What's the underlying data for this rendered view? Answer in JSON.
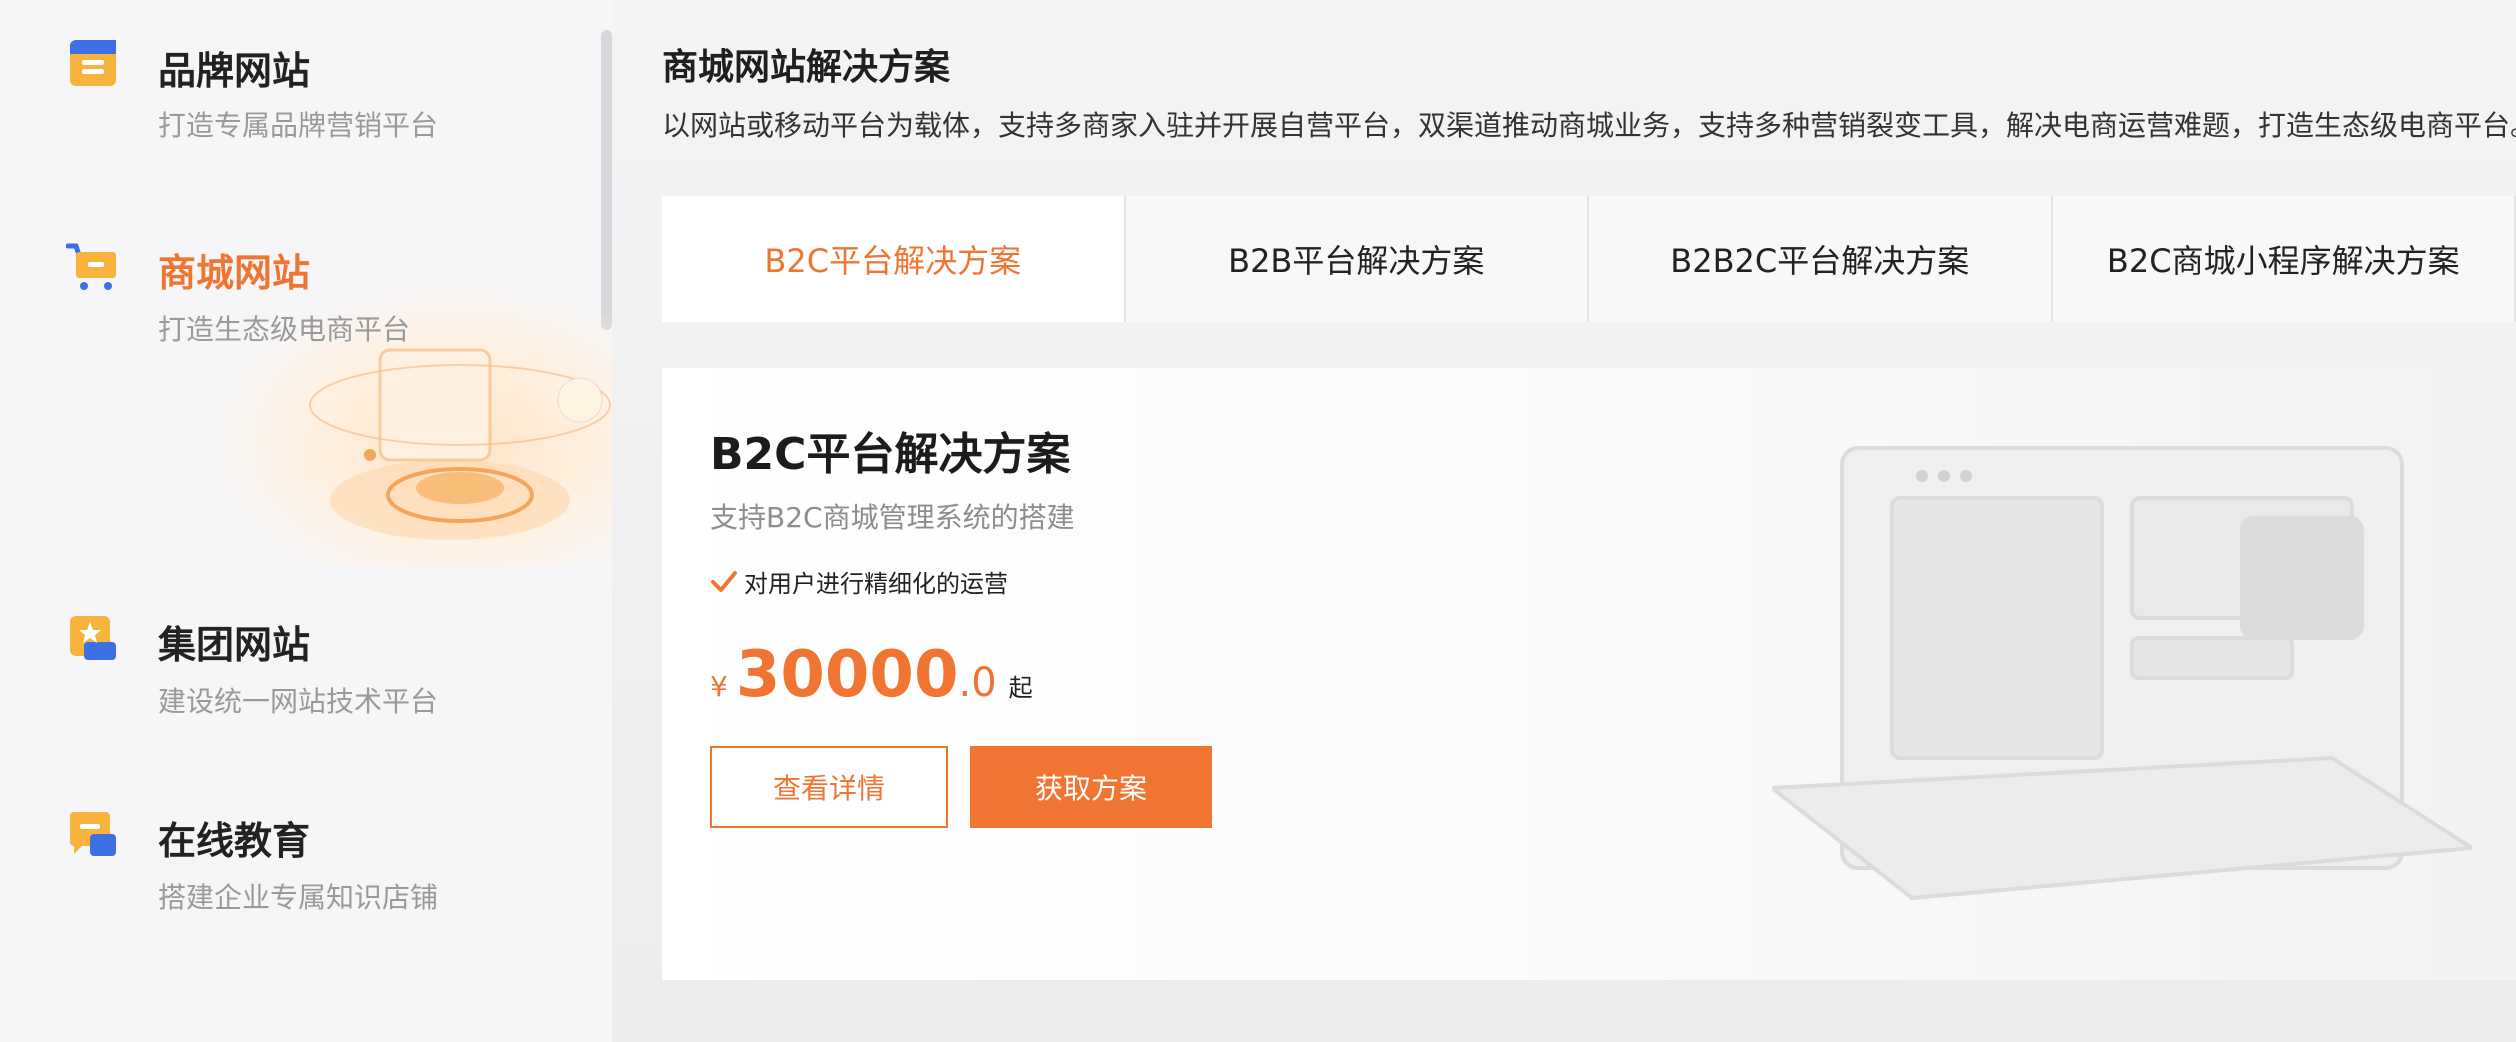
{
  "sidebar": {
    "items": [
      {
        "title": "品牌网站",
        "subtitle": "打造专属品牌营销平台",
        "icon": "brand-site-icon"
      },
      {
        "title": "商城网站",
        "subtitle": "打造生态级电商平台",
        "icon": "shopping-cart-icon"
      },
      {
        "title": "集团网站",
        "subtitle": "建设统一网站技术平台",
        "icon": "star-badge-icon"
      },
      {
        "title": "在线教育",
        "subtitle": "搭建企业专属知识店铺",
        "icon": "chat-bubble-icon"
      }
    ],
    "active_index": 1
  },
  "main": {
    "title": "商城网站解决方案",
    "description": "以网站或移动平台为载体，支持多商家入驻并开展自营平台，双渠道推动商城业务，支持多种营销裂变工具，解决电商运营难题，打造生态级电商平台。",
    "tabs": [
      {
        "label": "B2C平台解决方案"
      },
      {
        "label": "B2B平台解决方案"
      },
      {
        "label": "B2B2C平台解决方案"
      },
      {
        "label": "B2C商城小程序解决方案"
      }
    ],
    "active_tab": 0,
    "card": {
      "title": "B2C平台解决方案",
      "subtitle": "支持B2C商城管理系统的搭建",
      "feature": "对用户进行精细化的运营",
      "price": {
        "currency": "¥",
        "integer": "30000",
        "decimal": ".0",
        "suffix": "起"
      },
      "detail_button": "查看详情",
      "get_button": "获取方案"
    }
  },
  "colors": {
    "accent": "#f07533",
    "text": "#222222",
    "muted": "#9a9a9a"
  }
}
